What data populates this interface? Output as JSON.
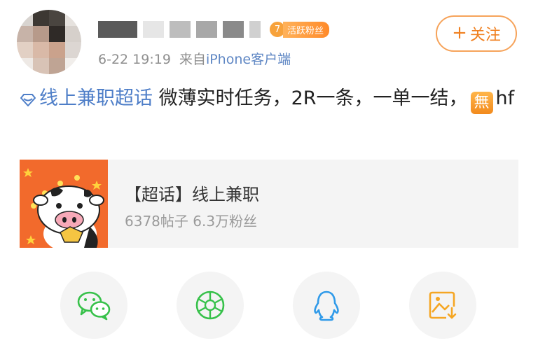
{
  "user": {
    "level": "7",
    "badge_label": "活跃粉丝",
    "time": "6-22 19:19",
    "source_prefix": "来自",
    "source": "iPhone客户端"
  },
  "follow_button": {
    "icon": "plus-icon",
    "label": "关注"
  },
  "post": {
    "topic": "线上兼职超话",
    "text": " 微薄实时任务，2R一条，一单一结，",
    "emoji_char": "無",
    "suffix": "hf"
  },
  "topic_card": {
    "title": "【超话】线上兼职",
    "stats": "6378帖子 6.3万粉丝"
  },
  "share_actions": [
    {
      "icon": "wechat-icon",
      "color": "#37c14a"
    },
    {
      "icon": "moments-icon",
      "color": "#37c14a"
    },
    {
      "icon": "qq-icon",
      "color": "#2f9ae9"
    },
    {
      "icon": "save-image-icon",
      "color": "#f5a623"
    }
  ],
  "colors": {
    "accent_orange": "#f08020",
    "link_blue": "#4e7ec8",
    "card_bg": "#f4f4f4"
  }
}
